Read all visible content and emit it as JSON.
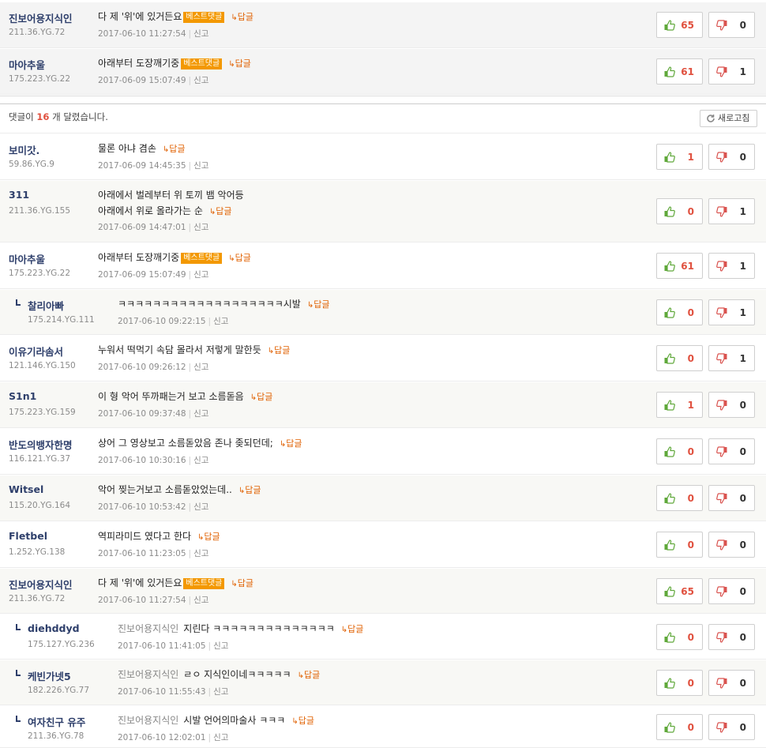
{
  "comment_count": {
    "prefix": "댓글이",
    "count": "16",
    "suffix": "개 달렸습니다.",
    "refresh_label": "새로고침"
  },
  "labels": {
    "reply": "답글",
    "report": "신고",
    "best_badge": "베스트댓글"
  },
  "best_comments": [
    {
      "nick": "진보어용지식인",
      "ip": "211.36.YG.72",
      "text": "다 제 '위'에 있거든요",
      "date": "2017-06-10 11:27:54",
      "up": "65",
      "down": "0",
      "best": true
    },
    {
      "nick": "마아추울",
      "ip": "175.223.YG.22",
      "text": "아래부터 도장깨기중",
      "date": "2017-06-09 15:07:49",
      "up": "61",
      "down": "1",
      "best": true
    }
  ],
  "comments": [
    {
      "nick": "보미갓.",
      "ip": "59.86.YG.9",
      "text": "물론 아냐 겸손",
      "date": "2017-06-09 14:45:35",
      "up": "1",
      "down": "0"
    },
    {
      "nick": "311",
      "ip": "211.36.YG.155",
      "text": "아래에서 벌레부터 위 토끼 뱀 악어등",
      "text2": "아래에서 위로 올라가는 순",
      "date": "2017-06-09 14:47:01",
      "up": "0",
      "down": "1"
    },
    {
      "nick": "마아추울",
      "ip": "175.223.YG.22",
      "text": "아래부터 도장깨기중",
      "date": "2017-06-09 15:07:49",
      "up": "61",
      "down": "1",
      "best": true
    },
    {
      "nick": "찰리아빠",
      "ip": "175.214.YG.111",
      "text": "ㅋㅋㅋㅋㅋㅋㅋㅋㅋㅋㅋㅋㅋㅋㅋㅋㅋㅋㅋ시발",
      "date": "2017-06-10 09:22:15",
      "up": "0",
      "down": "1",
      "reply": true
    },
    {
      "nick": "이유기라솜서",
      "ip": "121.146.YG.150",
      "text": "누워서 떡먹기 속담 몰라서 저렇게 말한듯",
      "date": "2017-06-10 09:26:12",
      "up": "0",
      "down": "1"
    },
    {
      "nick": "S1n1",
      "ip": "175.223.YG.159",
      "text": "이 형 악어 뚜까패는거 보고 소름돋음",
      "date": "2017-06-10 09:37:48",
      "up": "1",
      "down": "0"
    },
    {
      "nick": "반도의뱅자한명",
      "ip": "116.121.YG.37",
      "text": "상어 그 영상보고 소름돋았음 존나 좆되던데;",
      "date": "2017-06-10 10:30:16",
      "up": "0",
      "down": "0"
    },
    {
      "nick": "Witsel",
      "ip": "115.20.YG.164",
      "text": "악어 찢는거보고 소름돋았었는데..",
      "date": "2017-06-10 10:53:42",
      "up": "0",
      "down": "0"
    },
    {
      "nick": "Fletbel",
      "ip": "1.252.YG.138",
      "text": "역피라미드 였다고 한다",
      "date": "2017-06-10 11:23:05",
      "up": "0",
      "down": "0"
    },
    {
      "nick": "진보어용지식인",
      "ip": "211.36.YG.72",
      "text": "다 제 '위'에 있거든요",
      "date": "2017-06-10 11:27:54",
      "up": "65",
      "down": "0",
      "best": true
    },
    {
      "nick": "diehddyd",
      "ip": "175.127.YG.236",
      "mention": "진보어용지식인",
      "text": "지린다 ㅋㅋㅋㅋㅋㅋㅋㅋㅋㅋㅋㅋㅋㅋ",
      "date": "2017-06-10 11:41:05",
      "up": "0",
      "down": "0",
      "reply": true
    },
    {
      "nick": "케빈가넷5",
      "ip": "182.226.YG.77",
      "mention": "진보어용지식인",
      "text": "ㄹㅇ 지식인이네ㅋㅋㅋㅋㅋ",
      "date": "2017-06-10 11:55:43",
      "up": "0",
      "down": "0",
      "reply": true
    },
    {
      "nick": "여자친구 유주",
      "ip": "211.36.YG.78",
      "mention": "진보어용지식인",
      "text": "시발 언어의마술사 ㅋㅋㅋ",
      "date": "2017-06-10 12:02:01",
      "up": "0",
      "down": "0",
      "reply": true
    }
  ]
}
